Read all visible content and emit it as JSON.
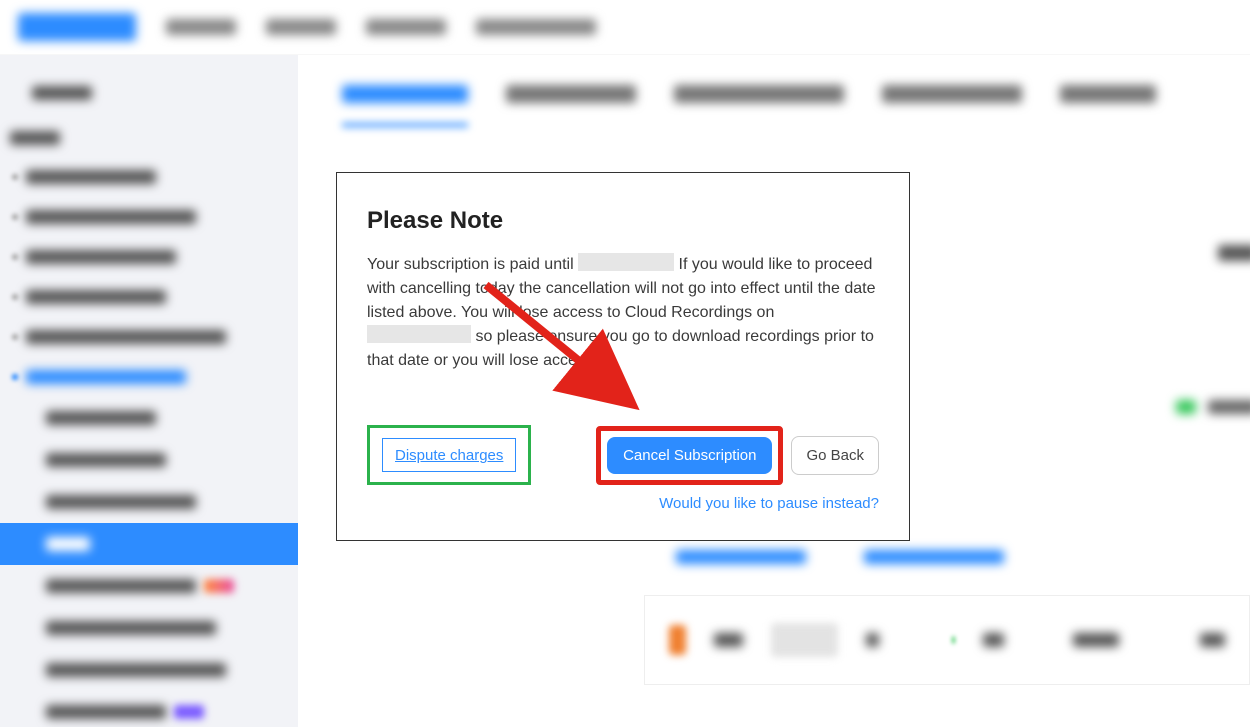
{
  "dialog": {
    "title": "Please Note",
    "body_part1": "Your subscription is paid until ",
    "body_part2": " If you would like to proceed with cancelling today the cancellation will not go into effect until the date listed above. You will lose access to Cloud Recordings on ",
    "body_part3": " so please ensure you go to download recordings prior to that date or you will lose access.",
    "dispute_label": "Dispute charges",
    "cancel_label": "Cancel Subscription",
    "back_label": "Go Back",
    "pause_label": "Would you like to pause instead?"
  },
  "annotations": {
    "green_box_target": "dispute-charges-link",
    "red_box_target": "cancel-subscription-button",
    "arrow_from": "dialog-body",
    "arrow_to": "cancel-subscription-button"
  },
  "colors": {
    "primary": "#2d8cff",
    "highlight_red": "#e2231a",
    "highlight_green": "#2bb24c"
  }
}
